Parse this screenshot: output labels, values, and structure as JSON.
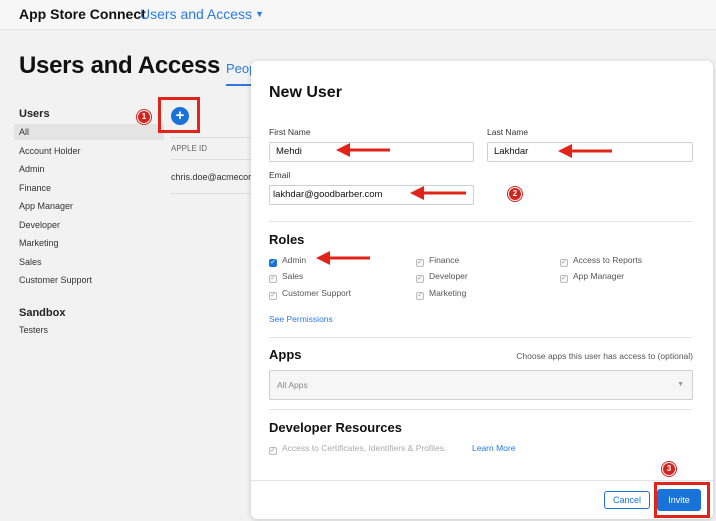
{
  "header": {
    "app_name": "App Store Connect",
    "section": "Users and Access",
    "chevron_icon": "chevron-down-icon"
  },
  "page": {
    "title": "Users and Access",
    "tab": "Peop"
  },
  "sidebar": {
    "users_heading": "Users",
    "items": [
      "All",
      "Account Holder",
      "Admin",
      "Finance",
      "App Manager",
      "Developer",
      "Marketing",
      "Sales",
      "Customer Support"
    ],
    "active_item": "All",
    "sandbox_heading": "Sandbox",
    "sandbox_items": [
      "Testers"
    ]
  },
  "list": {
    "add_icon": "+",
    "column_header": "APPLE ID",
    "rows": [
      "chris.doe@acmecor"
    ]
  },
  "annotations": {
    "step1": "1",
    "step2": "2",
    "step3": "3",
    "highlight_color": "#e2231a"
  },
  "modal": {
    "title": "New User",
    "first_name_label": "First Name",
    "first_name_value": "Mehdi",
    "last_name_label": "Last Name",
    "last_name_value": "Lakhdar",
    "email_label": "Email",
    "email_value": "lakhdar@goodbarber.com",
    "roles_title": "Roles",
    "roles": [
      {
        "label": "Admin",
        "checked": true
      },
      {
        "label": "Finance",
        "checked": false
      },
      {
        "label": "Access to Reports",
        "checked": false
      },
      {
        "label": "Sales",
        "checked": false
      },
      {
        "label": "Developer",
        "checked": false
      },
      {
        "label": "App Manager",
        "checked": false
      },
      {
        "label": "Customer Support",
        "checked": false
      },
      {
        "label": "Marketing",
        "checked": false
      }
    ],
    "see_permissions": "See Permissions",
    "apps_title": "Apps",
    "apps_hint": "Choose apps this user has access to (optional)",
    "apps_select_value": "All Apps",
    "dev_title": "Developer Resources",
    "dev_checkbox_label": "Access to Certificates, Identifiers & Profiles.",
    "learn_more": "Learn More",
    "cancel_label": "Cancel",
    "invite_label": "Invite"
  },
  "colors": {
    "accent": "#1a73d9",
    "link": "#2a7ae2"
  }
}
